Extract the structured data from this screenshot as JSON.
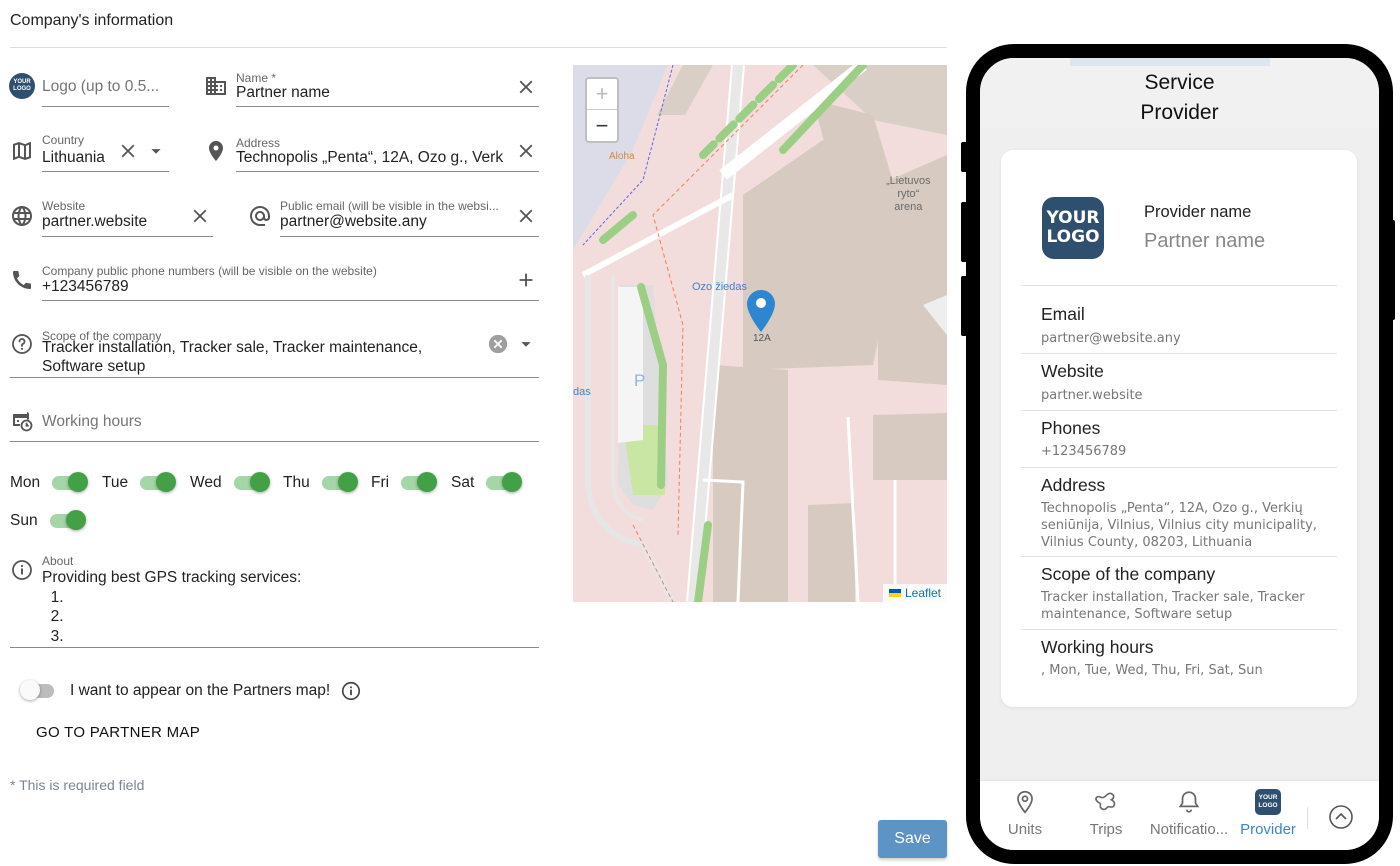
{
  "page": {
    "title": "Company's information"
  },
  "form": {
    "logo": {
      "placeholder": "Logo (up to 0.5..."
    },
    "name": {
      "label": "Name *",
      "value": "Partner name"
    },
    "country": {
      "label": "Country",
      "value": "Lithuania"
    },
    "address": {
      "label": "Address",
      "value": "Technopolis „Penta“, 12A, Ozo g., Verkių"
    },
    "website": {
      "label": "Website",
      "value": "partner.website"
    },
    "public_email": {
      "label": "Public email (will be visible in the websi...",
      "value": "partner@website.any"
    },
    "phones": {
      "label": "Company public phone numbers (will be visible on the website)",
      "value": "+123456789"
    },
    "scope": {
      "label": "Scope of the company",
      "line1": "Tracker installation, Tracker sale, Tracker maintenance,",
      "line2": "Software setup"
    },
    "working_hours": {
      "placeholder": "Working hours"
    },
    "days": [
      {
        "label": "Mon",
        "on": true
      },
      {
        "label": "Tue",
        "on": true
      },
      {
        "label": "Wed",
        "on": true
      },
      {
        "label": "Thu",
        "on": true
      },
      {
        "label": "Fri",
        "on": true
      },
      {
        "label": "Sat",
        "on": true
      },
      {
        "label": "Sun",
        "on": true
      }
    ],
    "about": {
      "label": "About",
      "value": "Providing best GPS tracking services:\n  1.\n  2.\n  3."
    },
    "partner_map_toggle": {
      "label": "I want to appear on the Partners map!",
      "on": false
    },
    "go_to_partner_map": "GO TO PARTNER MAP",
    "required_note": "* This is required field",
    "save": "Save"
  },
  "map": {
    "zoom_in": "+",
    "zoom_out": "−",
    "attribution": "Leaflet",
    "marker_label": "12A",
    "labels": {
      "aloha": "Aloha",
      "arena": "„Lietuvos\nryto“\narena",
      "ozo": "Ozo žiedas",
      "das": "das",
      "parking": "P"
    }
  },
  "phone": {
    "header_title_line1": "Service",
    "header_title_line2": "Provider",
    "logo_line1": "YOUR",
    "logo_line2": "LOGO",
    "provider_label": "Provider name",
    "provider_name": "Partner name",
    "sections": [
      {
        "title": "Email",
        "value": "partner@website.any"
      },
      {
        "title": "Website",
        "value": "partner.website"
      },
      {
        "title": "Phones",
        "value": "+123456789"
      },
      {
        "title": "Address",
        "value": "Technopolis „Penta“, 12A, Ozo g., Verkių seniūnija, Vilnius, Vilnius city municipality, Vilnius County, 08203, Lithuania"
      },
      {
        "title": "Scope of the company",
        "value": "Tracker installation, Tracker sale, Tracker maintenance, Software setup"
      },
      {
        "title": "Working hours",
        "value": ", Mon, Tue, Wed, Thu, Fri, Sat, Sun"
      }
    ],
    "nav": [
      {
        "label": "Units",
        "icon": "map-pin-icon"
      },
      {
        "label": "Trips",
        "icon": "trips-icon"
      },
      {
        "label": "Notificatio...",
        "icon": "bell-icon"
      },
      {
        "label": "Provider",
        "icon": "provider-logo-icon",
        "active": true
      }
    ]
  },
  "colors": {
    "accent": "#5e93c5",
    "toggle_on": "#43a047",
    "logo_bg": "#2e4f6e",
    "nav_active": "#3a86c8"
  }
}
